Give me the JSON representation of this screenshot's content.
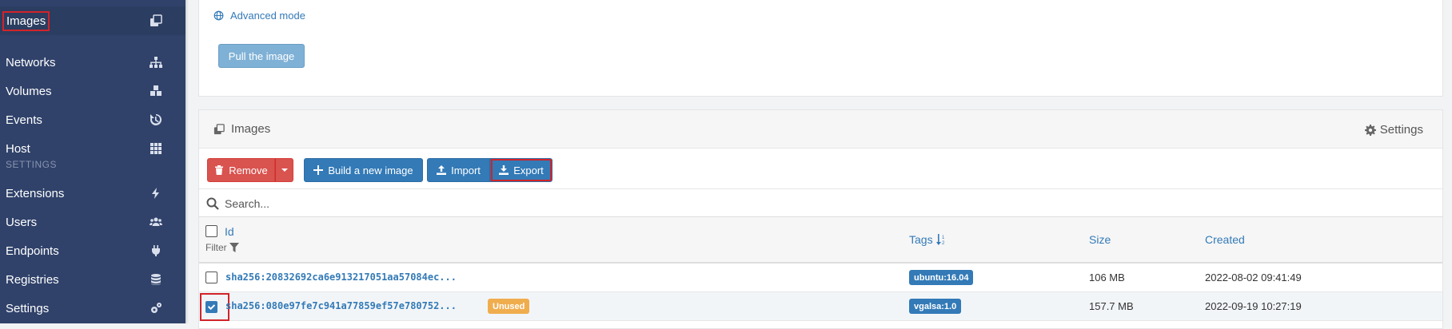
{
  "sidebar": {
    "items": [
      {
        "label": "Images",
        "icon": "clone-icon"
      },
      {
        "label": "Networks",
        "icon": "sitemap-icon"
      },
      {
        "label": "Volumes",
        "icon": "cubes-icon"
      },
      {
        "label": "Events",
        "icon": "history-icon"
      },
      {
        "label": "Host",
        "icon": "grid-icon"
      }
    ],
    "settings_header": "SETTINGS",
    "settings_items": [
      {
        "label": "Extensions",
        "icon": "bolt-icon"
      },
      {
        "label": "Users",
        "icon": "users-icon"
      },
      {
        "label": "Endpoints",
        "icon": "plug-icon"
      },
      {
        "label": "Registries",
        "icon": "database-icon"
      },
      {
        "label": "Settings",
        "icon": "cogs-icon"
      }
    ]
  },
  "pull_panel": {
    "advanced_mode": "Advanced mode",
    "pull_button": "Pull the image"
  },
  "images_panel": {
    "title": "Images",
    "settings": "Settings",
    "toolbar": {
      "remove": "Remove",
      "build": "Build a new image",
      "import": "Import",
      "export": "Export"
    },
    "search_placeholder": "Search...",
    "columns": {
      "id": "Id",
      "filter": "Filter",
      "tags": "Tags",
      "size": "Size",
      "created": "Created"
    },
    "rows": [
      {
        "id": "sha256:20832692ca6e913217051aa57084ec...",
        "unused": "",
        "tag": "ubuntu:16.04",
        "size": "106 MB",
        "created": "2022-08-02 09:41:49",
        "checked": false
      },
      {
        "id": "sha256:080e97fe7c941a77859ef57e780752...",
        "unused": "Unused",
        "tag": "vgalsa:1.0",
        "size": "157.7 MB",
        "created": "2022-09-19 10:27:19",
        "checked": true
      }
    ]
  },
  "colors": {
    "sidebar_bg": "#30426a",
    "primary": "#337ab7",
    "danger": "#d9534f",
    "warning": "#f0ad4e",
    "highlight": "#d2232a"
  }
}
